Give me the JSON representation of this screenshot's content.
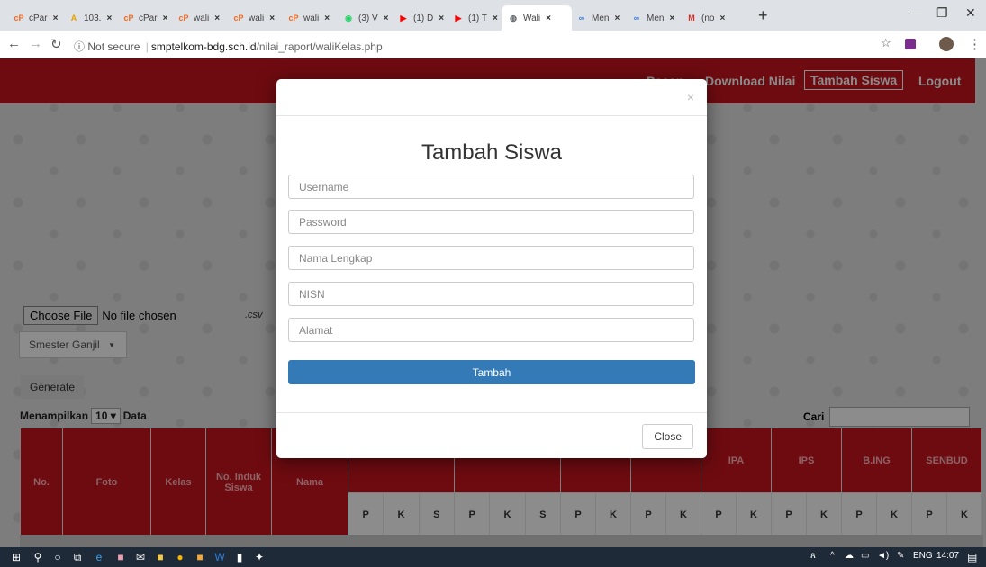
{
  "browser": {
    "tabs": [
      {
        "label": "cPar",
        "icon": "cpanel-icon",
        "color": "#f26b21"
      },
      {
        "label": "103.",
        "icon": "chart-icon",
        "color": "#e8a000"
      },
      {
        "label": "cPar",
        "icon": "cpanel-icon",
        "color": "#f26b21"
      },
      {
        "label": "wali",
        "icon": "cpanel-icon",
        "color": "#f26b21"
      },
      {
        "label": "wali",
        "icon": "cpanel-icon",
        "color": "#f26b21"
      },
      {
        "label": "wali",
        "icon": "cpanel-icon",
        "color": "#f26b21"
      },
      {
        "label": "(3) V",
        "icon": "whatsapp-icon",
        "color": "#25d366"
      },
      {
        "label": "(1) D",
        "icon": "youtube-icon",
        "color": "#ff0000"
      },
      {
        "label": "(1) T",
        "icon": "youtube-icon",
        "color": "#ff0000"
      },
      {
        "label": "Wali",
        "icon": "globe-icon",
        "color": "#5f6368"
      },
      {
        "label": "Men",
        "icon": "link-icon",
        "color": "#3b7ddd"
      },
      {
        "label": "Men",
        "icon": "link-icon",
        "color": "#3b7ddd"
      },
      {
        "label": "(no",
        "icon": "gmail-icon",
        "color": "#d93025"
      }
    ],
    "url_security": "Not secure",
    "url_host": "smptelkom-bdg.sch.id",
    "url_path": "/nilai_raport/waliKelas.php"
  },
  "navbar": {
    "links": [
      "Pesan",
      "Download Nilai",
      "Tambah Siswa",
      "Logout"
    ]
  },
  "upload": {
    "choose_label": "Choose File",
    "file_status": "No file chosen",
    "format_note": ".csv"
  },
  "semester_select": {
    "value": "Smester Ganjil"
  },
  "generate_label": "Generate",
  "show_entries": {
    "prefix": "Menampilkan",
    "value": "10",
    "suffix": "Data"
  },
  "search_label": "Cari",
  "table": {
    "fixed_headers": [
      "No.",
      "Foto",
      "Kelas",
      "No. Induk Siswa",
      "Nama"
    ],
    "subject_headers": [
      "IPA",
      "IPS",
      "B.ING",
      "SENBUD"
    ],
    "sub_headers": [
      "P",
      "K",
      "S",
      "P",
      "K",
      "S",
      "P",
      "K",
      "P",
      "K",
      "P",
      "K",
      "P",
      "K",
      "P",
      "K",
      "P",
      "K"
    ]
  },
  "modal": {
    "close_x": "×",
    "title": "Tambah Siswa",
    "placeholders": {
      "username": "Username",
      "password": "Password",
      "fullname": "Nama Lengkap",
      "nisn": "NISN",
      "address": "Alamat"
    },
    "submit_label": "Tambah",
    "close_label": "Close"
  },
  "taskbar": {
    "lang": "ENG",
    "time": "14:07"
  },
  "colors": {
    "navbar": "#c8141e",
    "primary_button": "#337ab7"
  }
}
